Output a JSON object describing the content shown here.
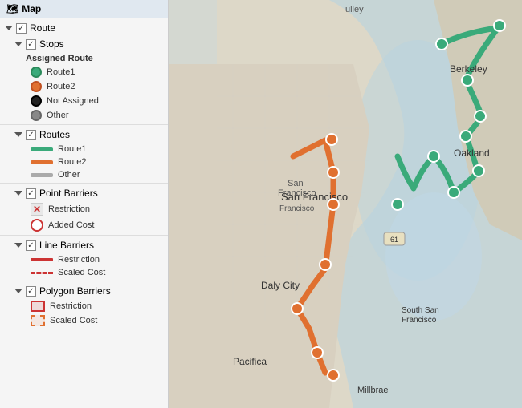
{
  "legend": {
    "title": "Map",
    "groups": [
      {
        "id": "route",
        "label": "Route",
        "checked": true,
        "children": [
          {
            "id": "stops",
            "label": "Stops",
            "checked": true,
            "categoryLabel": "Assigned Route",
            "items": [
              {
                "id": "route1-stop",
                "iconType": "route1-dot",
                "label": "Route1"
              },
              {
                "id": "route2-stop",
                "iconType": "route2-dot",
                "label": "Route2"
              },
              {
                "id": "not-assigned",
                "iconType": "not-assigned-dot",
                "label": "Not Assigned"
              },
              {
                "id": "other-stop",
                "iconType": "other-dot",
                "label": "Other"
              }
            ]
          },
          {
            "id": "routes",
            "label": "Routes",
            "checked": true,
            "items": [
              {
                "id": "route1-line",
                "iconType": "route1-line",
                "label": "Route1"
              },
              {
                "id": "route2-line",
                "iconType": "route2-line",
                "label": "Route2"
              },
              {
                "id": "other-line",
                "iconType": "other-line",
                "label": "Other"
              }
            ]
          },
          {
            "id": "point-barriers",
            "label": "Point Barriers",
            "checked": true,
            "items": [
              {
                "id": "point-restriction",
                "iconType": "restriction-x",
                "label": "Restriction"
              },
              {
                "id": "point-added-cost",
                "iconType": "added-cost-circle",
                "label": "Added Cost"
              }
            ]
          },
          {
            "id": "line-barriers",
            "label": "Line Barriers",
            "checked": true,
            "items": [
              {
                "id": "line-restriction",
                "iconType": "line-restriction",
                "label": "Restriction"
              },
              {
                "id": "line-scaled",
                "iconType": "line-scaled",
                "label": "Scaled Cost"
              }
            ]
          },
          {
            "id": "polygon-barriers",
            "label": "Polygon Barriers",
            "checked": true,
            "items": [
              {
                "id": "poly-restriction",
                "iconType": "poly-restriction",
                "label": "Restriction"
              },
              {
                "id": "poly-scaled",
                "iconType": "poly-scaled",
                "label": "Scaled Cost"
              }
            ]
          }
        ]
      }
    ]
  },
  "map": {
    "city_labels": [
      "San Francisco",
      "Berkeley",
      "Oakland",
      "Daly City",
      "South San Francisco",
      "Pacifica",
      "Millbrae"
    ],
    "route_colors": {
      "route1": "#3aaa7a",
      "route2": "#e07030"
    }
  }
}
